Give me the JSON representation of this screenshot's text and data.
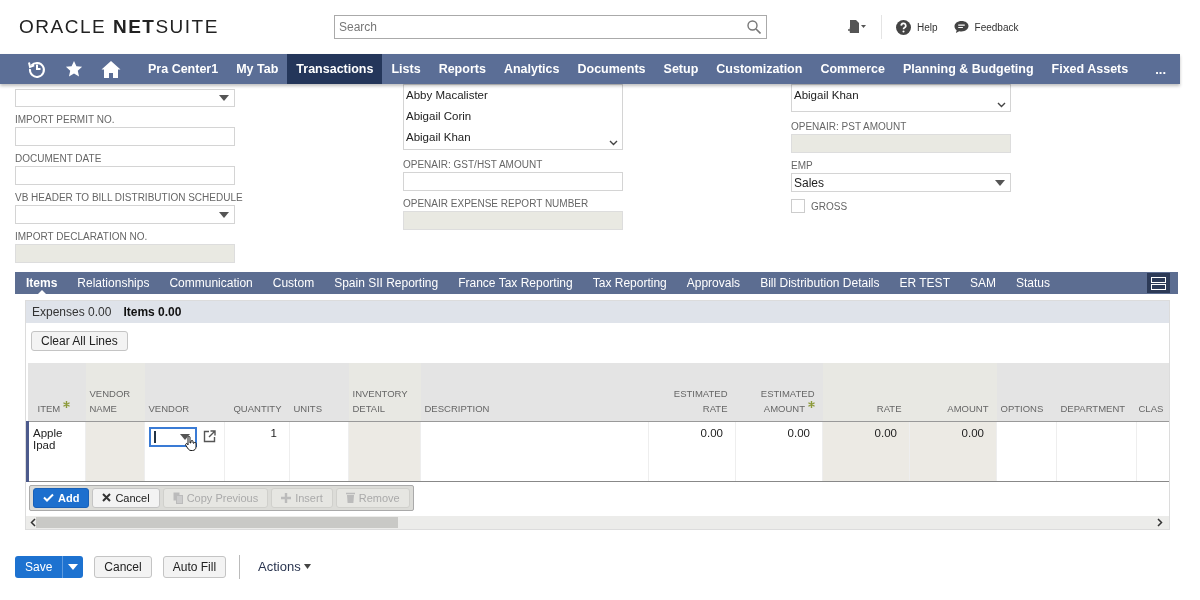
{
  "header": {
    "logo": {
      "brand": "ORACLE",
      "product": "**NET**SUITE"
    },
    "search": {
      "placeholder": "Search"
    },
    "links": [
      {
        "kind": "help",
        "label": "Help"
      },
      {
        "kind": "feedback",
        "label": "Feedback"
      }
    ]
  },
  "nav": {
    "items": [
      {
        "label": "Pra Center1",
        "selected": false
      },
      {
        "label": "My Tab",
        "selected": false
      },
      {
        "label": "Transactions",
        "selected": true
      },
      {
        "label": "Lists",
        "selected": false
      },
      {
        "label": "Reports",
        "selected": false
      },
      {
        "label": "Analytics",
        "selected": false
      },
      {
        "label": "Documents",
        "selected": false
      },
      {
        "label": "Setup",
        "selected": false
      },
      {
        "label": "Customization",
        "selected": false
      },
      {
        "label": "Commerce",
        "selected": false
      },
      {
        "label": "Planning & Budgeting",
        "selected": false
      },
      {
        "label": "Fixed Assets",
        "selected": false
      }
    ],
    "more": "..."
  },
  "form": {
    "columns": [
      {
        "fields": [
          {
            "kind": "select",
            "disabled": false
          },
          {
            "kind": "text",
            "label": "IMPORT PERMIT NO.",
            "disabled": false
          },
          {
            "kind": "text",
            "label": "DOCUMENT DATE",
            "disabled": false
          },
          {
            "kind": "select",
            "label": "VB HEADER TO BILL DISTRIBUTION SCHEDULE",
            "disabled": false
          },
          {
            "kind": "text",
            "label": "IMPORT DECLARATION NO.",
            "disabled": true
          }
        ]
      },
      {
        "fields": [
          {
            "kind": "listbox",
            "options": [
              "Abby Macalister",
              "Abigail Corin",
              "Abigail Khan"
            ],
            "disabled": false
          },
          {
            "kind": "text",
            "label": "OPENAIR: GST/HST AMOUNT",
            "disabled": false
          },
          {
            "kind": "text",
            "label": "OPENAIR EXPENSE REPORT NUMBER",
            "disabled": true
          }
        ]
      },
      {
        "fields": [
          {
            "kind": "listbox",
            "options": [
              "Abigail Khan"
            ],
            "disabled": false
          },
          {
            "kind": "text",
            "label": "OPENAIR: PST AMOUNT",
            "disabled": true
          },
          {
            "kind": "select",
            "label": "EMP",
            "value": "Sales",
            "disabled": false
          },
          {
            "kind": "checkbox",
            "label": "GROSS",
            "checked": false,
            "disabled": false
          }
        ]
      }
    ]
  },
  "subtabs": [
    {
      "label": "Items",
      "selected": true
    },
    {
      "label": "Relationships",
      "selected": false
    },
    {
      "label": "Communication",
      "selected": false
    },
    {
      "label": "Custom",
      "selected": false
    },
    {
      "label": "Spain SII Reporting",
      "selected": false
    },
    {
      "label": "France Tax Reporting",
      "selected": false
    },
    {
      "label": "Tax Reporting",
      "selected": false
    },
    {
      "label": "Approvals",
      "selected": false
    },
    {
      "label": "Bill Distribution Details",
      "selected": false
    },
    {
      "label": "ER TEST",
      "selected": false
    },
    {
      "label": "SAM",
      "selected": false
    },
    {
      "label": "Status",
      "selected": false
    }
  ],
  "items_panel": {
    "tabs": [
      {
        "label": "Expenses 0.00",
        "selected": false
      },
      {
        "label": "Items 0.00",
        "selected": true
      }
    ],
    "clear_button": "Clear All Lines",
    "columns": [
      {
        "label": "ITEM",
        "kind": "text",
        "required": true,
        "disabled": false
      },
      {
        "label": "VENDOR NAME",
        "kind": "text",
        "required": false,
        "disabled": true
      },
      {
        "label": "VENDOR",
        "kind": "select",
        "required": false,
        "disabled": false
      },
      {
        "label": "QUANTITY",
        "kind": "number",
        "required": false,
        "disabled": false
      },
      {
        "label": "UNITS",
        "kind": "text",
        "required": false,
        "disabled": false
      },
      {
        "label": "INVENTORY DETAIL",
        "kind": "text",
        "required": false,
        "disabled": true
      },
      {
        "label": "DESCRIPTION",
        "kind": "text",
        "required": false,
        "disabled": false
      },
      {
        "label": "ESTIMATED RATE",
        "kind": "number",
        "required": false,
        "disabled": false
      },
      {
        "label": "ESTIMATED AMOUNT",
        "kind": "number",
        "required": true,
        "disabled": false
      },
      {
        "label": "RATE",
        "kind": "number",
        "required": false,
        "disabled": true
      },
      {
        "label": "AMOUNT",
        "kind": "number",
        "required": false,
        "disabled": true
      },
      {
        "label": "OPTIONS",
        "kind": "text",
        "required": false,
        "disabled": false
      },
      {
        "label": "DEPARTMENT",
        "kind": "text",
        "required": false,
        "disabled": false
      },
      {
        "label": "CLAS",
        "kind": "text",
        "required": false,
        "disabled": false
      }
    ],
    "rows": [
      {
        "current": true,
        "cells": [
          {
            "text": "Apple Ipad"
          },
          {},
          {
            "focused": true
          },
          {
            "text": "1"
          },
          {},
          {},
          {},
          {
            "text": "0.00"
          },
          {
            "text": "0.00"
          },
          {
            "text": "0.00"
          },
          {
            "text": "0.00"
          },
          {},
          {},
          {}
        ]
      }
    ],
    "line_buttons": [
      {
        "kind": "add",
        "label": "Add",
        "disabled": false
      },
      {
        "kind": "cancel",
        "label": "Cancel",
        "disabled": false
      },
      {
        "kind": "copy",
        "label": "Copy Previous",
        "disabled": true
      },
      {
        "kind": "insert",
        "label": "Insert",
        "disabled": true
      },
      {
        "kind": "remove",
        "label": "Remove",
        "disabled": true
      }
    ]
  },
  "footer": {
    "save": "Save",
    "buttons": [
      "Cancel",
      "Auto Fill"
    ],
    "actions": "Actions"
  }
}
